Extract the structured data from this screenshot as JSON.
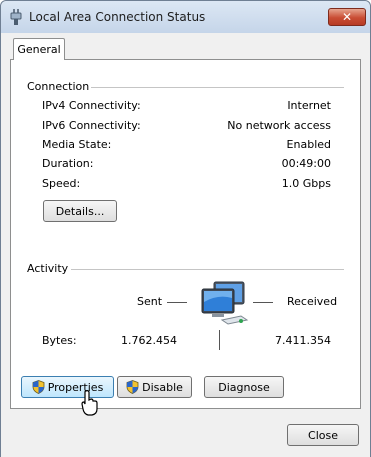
{
  "window": {
    "title": "Local Area Connection Status",
    "close_label": "✕"
  },
  "tabs": [
    {
      "label": "General",
      "selected": true
    }
  ],
  "connection": {
    "heading": "Connection",
    "rows": [
      {
        "label": "IPv4 Connectivity:",
        "value": "Internet"
      },
      {
        "label": "IPv6 Connectivity:",
        "value": "No network access"
      },
      {
        "label": "Media State:",
        "value": "Enabled"
      },
      {
        "label": "Duration:",
        "value": "00:49:00"
      },
      {
        "label": "Speed:",
        "value": "1.0 Gbps"
      }
    ],
    "details_button": "Details..."
  },
  "activity": {
    "heading": "Activity",
    "sent_label": "Sent",
    "received_label": "Received",
    "bytes_label": "Bytes:",
    "bytes_sent": "1.762.454",
    "bytes_received": "7.411.354"
  },
  "actions": {
    "properties": "Properties",
    "disable": "Disable",
    "diagnose": "Diagnose"
  },
  "footer": {
    "close": "Close"
  },
  "colors": {
    "titlebar": "#c5d5e9",
    "close_button": "#c94d34",
    "focus_button": "#bee6fd"
  }
}
